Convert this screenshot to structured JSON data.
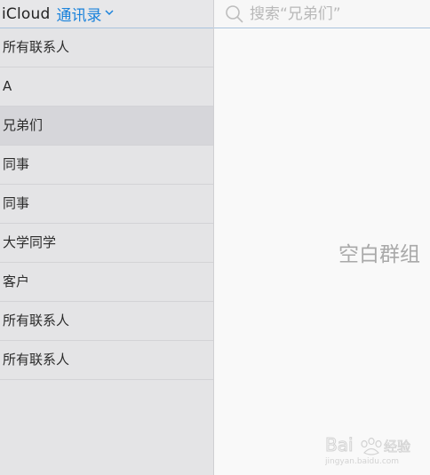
{
  "header": {
    "brand": "iCloud",
    "app_name": "通讯录"
  },
  "sidebar": {
    "groups": [
      {
        "label": "所有联系人"
      },
      {
        "label": "A"
      },
      {
        "label": "兄弟们",
        "selected": true
      },
      {
        "label": "同事"
      },
      {
        "label": "同事"
      },
      {
        "label": "大学同学"
      },
      {
        "label": "客户"
      },
      {
        "label": "所有联系人"
      },
      {
        "label": "所有联系人"
      }
    ]
  },
  "search": {
    "placeholder": "搜索“兄弟们”"
  },
  "main": {
    "empty_message": "空白群组"
  },
  "watermark": {
    "text": "Bai 经验",
    "url": "jingyan.baidu.com"
  },
  "colors": {
    "accent": "#1a82db",
    "sidebar_bg": "#e4e4e6",
    "selected_bg": "#d6d6da"
  }
}
